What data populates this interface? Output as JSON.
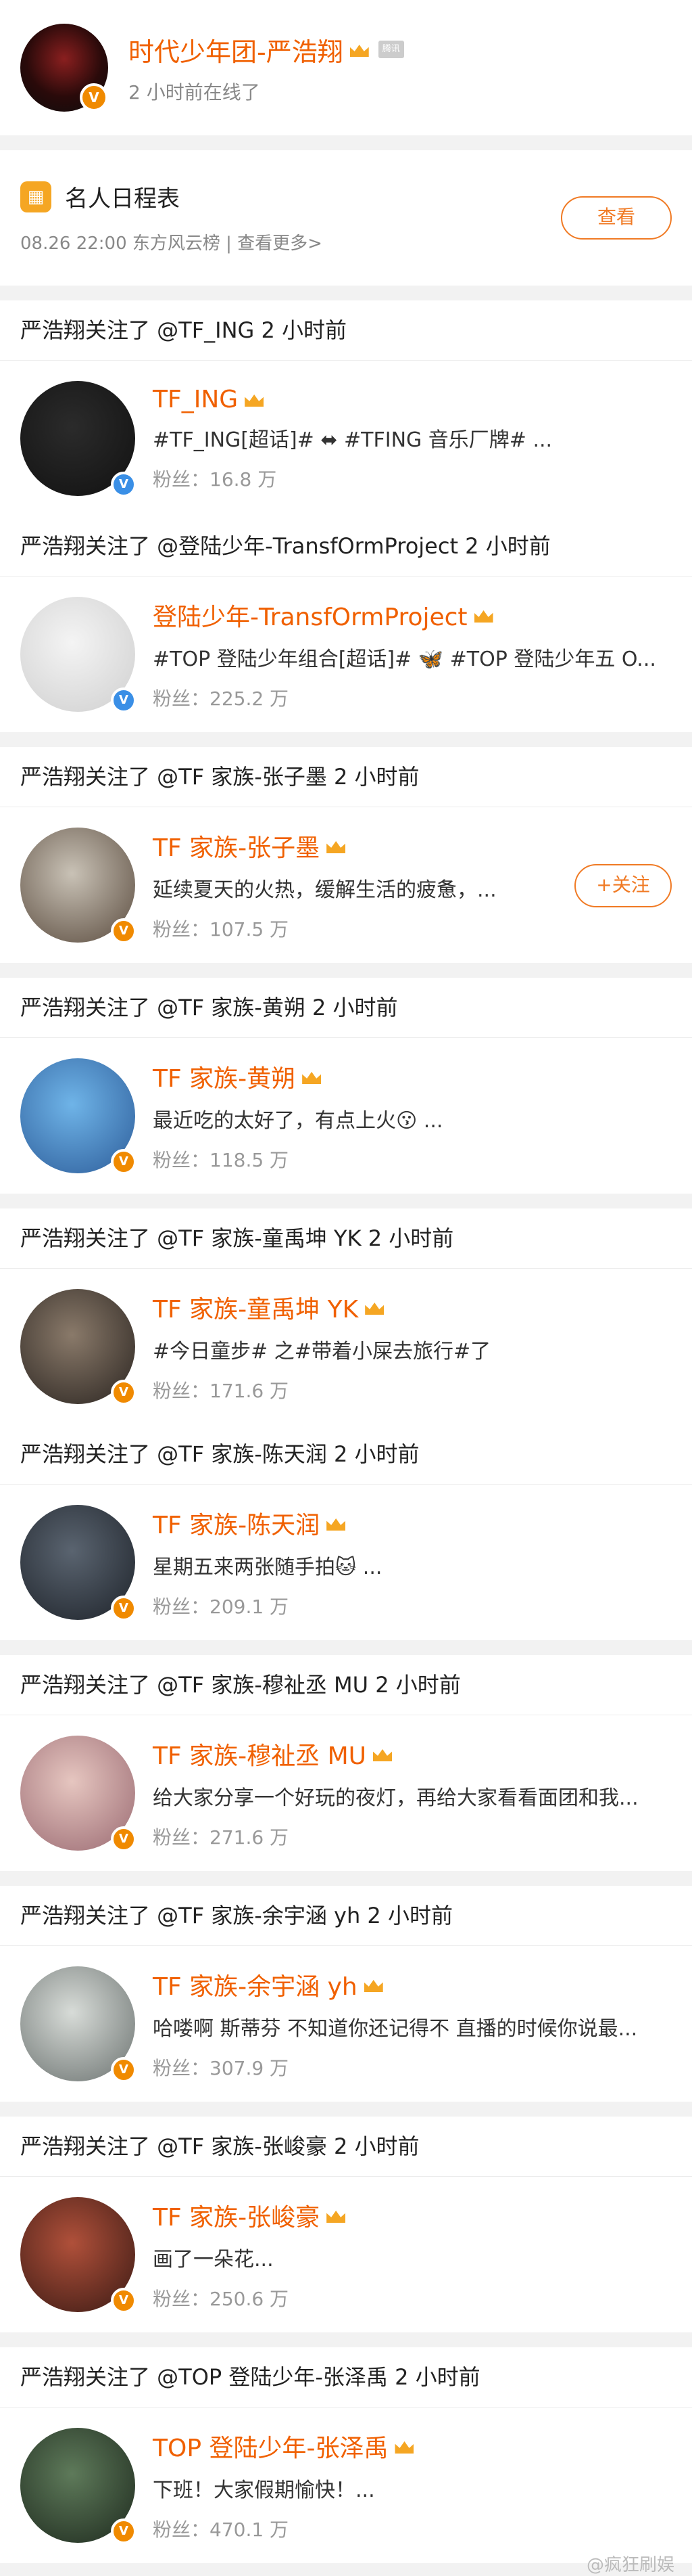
{
  "profile": {
    "name": "时代少年团-严浩翔",
    "status": "2 小时前在线了",
    "vip_label": "腾讯"
  },
  "schedule": {
    "title": "名人日程表",
    "meta": "08.26 22:00 东方风云榜 |  查看更多>",
    "button": "查看"
  },
  "follows": [
    {
      "header": "严浩翔关注了 @TF_ING 2 小时前",
      "name": "TF_ING",
      "desc": "#TF_ING[超话]#  ⬌  #TFING 音乐厂牌# ...",
      "fans": "粉丝：16.8 万",
      "badge": "blue",
      "avatar_colors": [
        "#2b2b2b",
        "#111111"
      ]
    },
    {
      "header": "严浩翔关注了 @登陆少年-TransfOrmProject 2 小时前",
      "name": "登陆少年-TransfOrmProject",
      "desc": "#TOP 登陆少年组合[超话]# 🦋 #TOP 登陆少年五 O...",
      "fans": "粉丝：225.2 万",
      "badge": "blue",
      "avatar_colors": [
        "#f4f4f4",
        "#cfcfcf"
      ]
    },
    {
      "header": "严浩翔关注了 @TF 家族-张子墨 2 小时前",
      "name": "TF 家族-张子墨",
      "desc": "延续夏天的火热，缓解生活的疲惫，...",
      "fans": "粉丝：107.5 万",
      "badge": "orange",
      "follow_button": "+关注",
      "avatar_colors": [
        "#c9c2b6",
        "#5a4b3e"
      ]
    },
    {
      "header": "严浩翔关注了 @TF 家族-黄朔 2 小时前",
      "name": "TF 家族-黄朔",
      "desc": "最近吃的太好了，有点上火😗 ...",
      "fans": "粉丝：118.5 万",
      "badge": "orange",
      "avatar_colors": [
        "#6fb4e8",
        "#2d5d9a"
      ]
    },
    {
      "header": "严浩翔关注了 @TF 家族-童禹坤 YK 2 小时前",
      "name": "TF 家族-童禹坤 YK",
      "desc": "#今日童步# 之#带着小屎去旅行#了",
      "fans": "粉丝：171.6 万",
      "badge": "orange",
      "avatar_colors": [
        "#8a7a6a",
        "#2a2420"
      ]
    },
    {
      "header": "严浩翔关注了 @TF 家族-陈天润 2 小时前",
      "name": "TF 家族-陈天润",
      "desc": "星期五来两张随手拍🐱 ...",
      "fans": "粉丝：209.1 万",
      "badge": "orange",
      "avatar_colors": [
        "#5a6470",
        "#1e232a"
      ]
    },
    {
      "header": "严浩翔关注了 @TF 家族-穆祉丞 MU 2 小时前",
      "name": "TF 家族-穆祉丞 MU",
      "desc": "给大家分享一个好玩的夜灯，再给大家看看面团和我...",
      "fans": "粉丝：271.6 万",
      "badge": "orange",
      "avatar_colors": [
        "#e6c6c0",
        "#9a6a72"
      ]
    },
    {
      "header": "严浩翔关注了 @TF 家族-余宇涵 yh 2 小时前",
      "name": "TF 家族-余宇涵 yh",
      "desc": "哈喽啊 斯蒂芬 不知道你还记得不 直播的时候你说最...",
      "fans": "粉丝：307.9 万",
      "badge": "orange",
      "avatar_colors": [
        "#d8dcd8",
        "#6b7270"
      ]
    },
    {
      "header": "严浩翔关注了 @TF 家族-张峻豪 2 小时前",
      "name": "TF 家族-张峻豪",
      "desc": "画了一朵花...",
      "fans": "粉丝：250.6 万",
      "badge": "orange",
      "avatar_colors": [
        "#b0503a",
        "#3a1a14"
      ]
    },
    {
      "header": "严浩翔关注了 @TOP 登陆少年-张泽禹 2 小时前",
      "name": "TOP 登陆少年-张泽禹",
      "desc": "下班！大家假期愉快！...",
      "fans": "粉丝：470.1 万",
      "badge": "orange",
      "avatar_colors": [
        "#5e7a5a",
        "#1e2a1e"
      ]
    }
  ],
  "watermark": "@疯狂刷娱"
}
